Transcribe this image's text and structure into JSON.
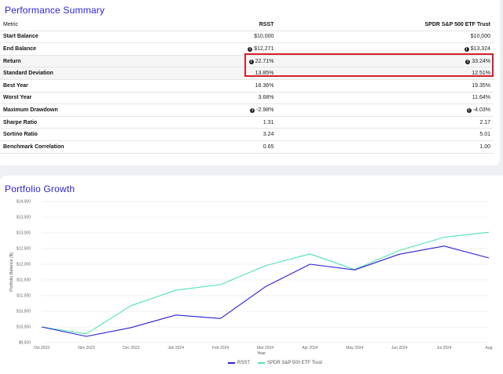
{
  "performance": {
    "title": "Performance Summary",
    "headers": {
      "metric": "Metric",
      "rsst": "RSST",
      "spy": "SPDR S&P 500 ETF Trust"
    },
    "rows": [
      {
        "metric": "Start Balance",
        "rsst": "$10,000",
        "spy": "$10,000",
        "rsst_info": false,
        "spy_info": false
      },
      {
        "metric": "End Balance",
        "rsst": "$12,271",
        "spy": "$13,324",
        "rsst_info": true,
        "spy_info": true
      },
      {
        "metric": "Return",
        "rsst": "22.71%",
        "spy": "33.24%",
        "rsst_info": true,
        "spy_info": true
      },
      {
        "metric": "Standard Deviation",
        "rsst": "13.85%",
        "spy": "12.51%",
        "rsst_info": false,
        "spy_info": false
      },
      {
        "metric": "Best Year",
        "rsst": "18.36%",
        "spy": "19.35%",
        "rsst_info": false,
        "spy_info": false
      },
      {
        "metric": "Worst Year",
        "rsst": "3.68%",
        "spy": "11.64%",
        "rsst_info": false,
        "spy_info": false
      },
      {
        "metric": "Maximum Drawdown",
        "rsst": "-2.98%",
        "spy": "-4.03%",
        "rsst_info": true,
        "spy_info": true
      },
      {
        "metric": "Sharpe Ratio",
        "rsst": "1.31",
        "spy": "2.17",
        "rsst_info": false,
        "spy_info": false
      },
      {
        "metric": "Sortino Ratio",
        "rsst": "3.24",
        "spy": "5.01",
        "rsst_info": false,
        "spy_info": false
      },
      {
        "metric": "Benchmark Correlation",
        "rsst": "0.65",
        "spy": "1.00",
        "rsst_info": false,
        "spy_info": false
      }
    ],
    "highlight_color": "#d4202a"
  },
  "growth": {
    "title": "Portfolio Growth"
  },
  "chart_data": {
    "type": "line",
    "xlabel": "Year",
    "ylabel": "Portfolio Balance ($)",
    "categories": [
      "Oct 2023",
      "Nov 2023",
      "Dec 2023",
      "Jan 2024",
      "Feb 2024",
      "Mar 2024",
      "Apr 2024",
      "May 2024",
      "Jun 2024",
      "Jul 2024",
      "Aug"
    ],
    "y_ticks": [
      "$9,500",
      "$10,000",
      "$10,500",
      "$11,000",
      "$11,500",
      "$12,000",
      "$12,500",
      "$13,000",
      "$13,500",
      "$14,000"
    ],
    "ylim": [
      9500,
      14000
    ],
    "grid": true,
    "legend_position": "bottom",
    "series": [
      {
        "name": "RSST",
        "color": "#2a1fd6",
        "values": [
          10000,
          9700,
          9980,
          10380,
          10270,
          11280,
          12000,
          11820,
          12320,
          12580,
          12200
        ]
      },
      {
        "name": "SPDR S&P 500 ETF Trust",
        "color": "#4fe3b4",
        "values": [
          10000,
          9780,
          10680,
          11170,
          11350,
          11950,
          12330,
          11830,
          12440,
          12860,
          13020
        ]
      }
    ]
  }
}
